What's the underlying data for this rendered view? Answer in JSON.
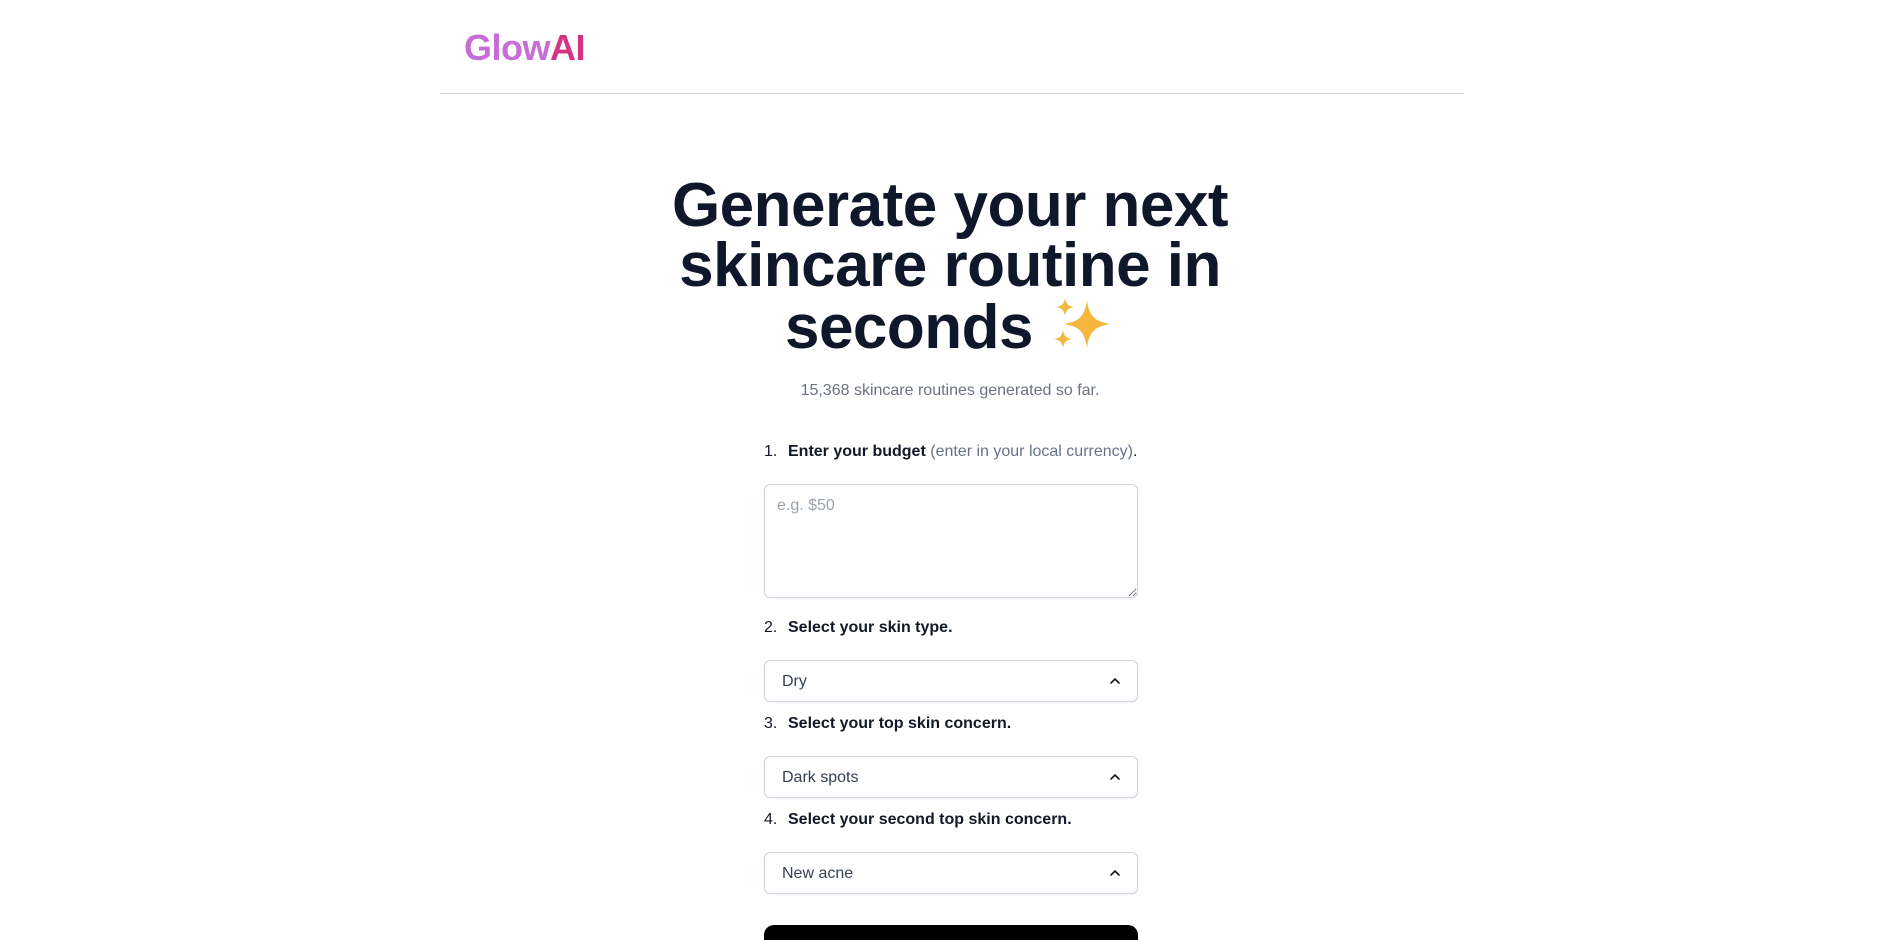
{
  "header": {
    "logo_part1": "Glow",
    "logo_part2": "AI"
  },
  "hero": {
    "title": "Generate your next skincare routine in seconds",
    "title_emoji": "✨",
    "subtitle": "15,368 skincare routines generated so far."
  },
  "form": {
    "step1": {
      "number": "1.",
      "label": "Enter your budget",
      "hint": "(enter in your local currency)",
      "suffix": ".",
      "placeholder": "e.g. $50"
    },
    "step2": {
      "number": "2.",
      "label": "Select your skin type.",
      "value": "Dry"
    },
    "step3": {
      "number": "3.",
      "label": "Select your top skin concern.",
      "value": "Dark spots"
    },
    "step4": {
      "number": "4.",
      "label": "Select your second top skin concern.",
      "value": "New acne"
    }
  },
  "icons": {
    "chevron": "chevron-up-icon",
    "sparkles": "sparkles-icon"
  },
  "colors": {
    "logo_glow": "#c86dd7",
    "logo_ai": "#d63384",
    "title": "#0f172a",
    "muted": "#64748b",
    "button": "#000000"
  }
}
